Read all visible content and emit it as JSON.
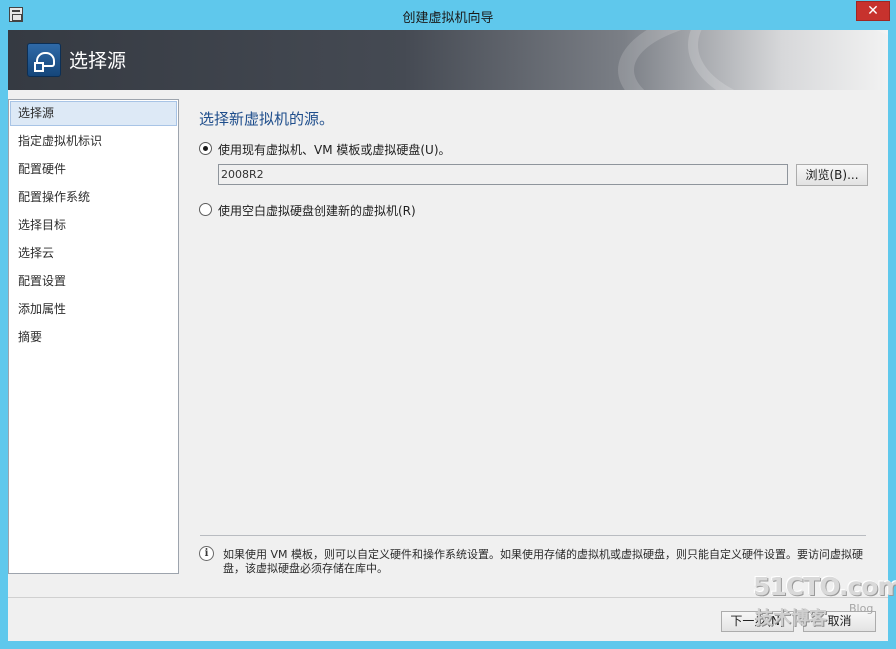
{
  "window": {
    "title": "创建虚拟机向导",
    "close_glyph": "✕"
  },
  "header": {
    "title": "选择源"
  },
  "nav": {
    "items": [
      {
        "label": "选择源",
        "selected": true
      },
      {
        "label": "指定虚拟机标识",
        "selected": false
      },
      {
        "label": "配置硬件",
        "selected": false
      },
      {
        "label": "配置操作系统",
        "selected": false
      },
      {
        "label": "选择目标",
        "selected": false
      },
      {
        "label": "选择云",
        "selected": false
      },
      {
        "label": "配置设置",
        "selected": false
      },
      {
        "label": "添加属性",
        "selected": false
      },
      {
        "label": "摘要",
        "selected": false
      }
    ]
  },
  "main": {
    "title": "选择新虚拟机的源。",
    "option_existing": {
      "label": "使用现有虚拟机、VM 模板或虚拟硬盘(U)。",
      "checked": true
    },
    "source_input": {
      "value": "2008R2"
    },
    "browse_label": "浏览(B)...",
    "option_blank": {
      "label": "使用空白虚拟硬盘创建新的虚拟机(R)",
      "checked": false
    },
    "info_glyph": "i",
    "info_text": "如果使用 VM 模板，则可以自定义硬件和操作系统设置。如果使用存储的虚拟机或虚拟硬盘，则只能自定义硬件设置。要访问虚拟硬盘，该虚拟硬盘必须存储在库中。"
  },
  "footer": {
    "next_label": "下一步(N)",
    "cancel_label": "取消"
  },
  "watermark": {
    "main": "51CTO.com",
    "sub": "技术博客",
    "blog": "Blog"
  },
  "colors": {
    "title_bar": "#5fc8ec",
    "close_button": "#c7322d",
    "selected_nav": "#dde9f6",
    "heading_blue": "#1f4e8c"
  }
}
